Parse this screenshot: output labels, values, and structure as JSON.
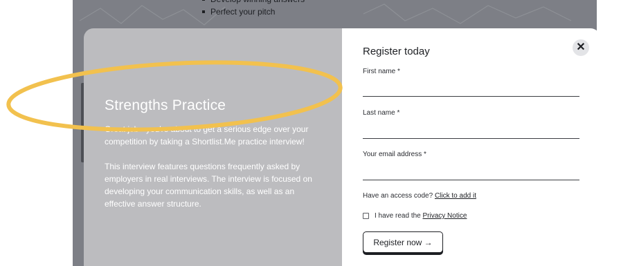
{
  "background": {
    "bullets": [
      "Develop winning answers",
      "Perfect your pitch"
    ]
  },
  "modal": {
    "left": {
      "title": "Strengths Practice",
      "paragraph1": "Great job - you're about to get a serious edge over your competition by taking a Shortlist.Me practice interview!",
      "paragraph2": "This interview features questions frequently asked by employers in real interviews. The interview is focused on developing your communication skills, as well as an effective answer structure."
    },
    "right": {
      "title": "Register today",
      "close_icon": "close-icon",
      "fields": {
        "first_name": "First name *",
        "last_name": "Last name *",
        "email": "Your email address *"
      },
      "access_text": "Have an access code?",
      "access_link": "Click to add it",
      "privacy_text": "I have read the",
      "privacy_link": "Privacy Notice",
      "register_button": "Register now →"
    }
  },
  "colors": {
    "overlay": "#7d7f86",
    "modal_left": "#bcbcbf",
    "annotation": "#f2c14e"
  }
}
